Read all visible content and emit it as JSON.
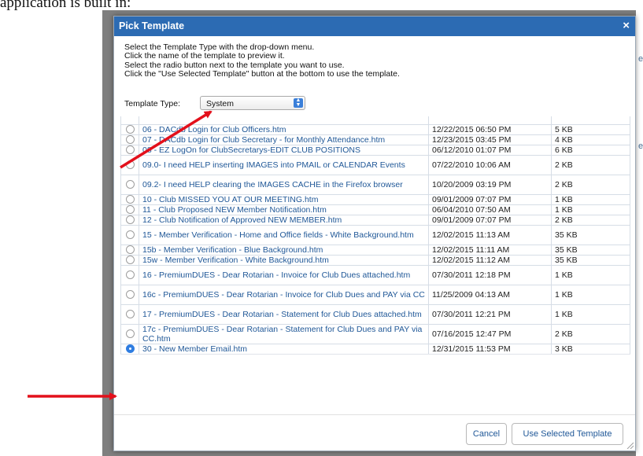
{
  "page": {
    "caption": "application is built in:",
    "background_letters": [
      "e",
      "e"
    ]
  },
  "dialog": {
    "title": "Pick Template",
    "close_symbol": "×",
    "instructions": [
      "Select the Template Type with the drop-down menu.",
      "Click the name of the template to preview it.",
      "Select the radio button next to the template you want to use.",
      "Click the \"Use Selected Template\" button at the bottom to use the template."
    ],
    "template_type": {
      "label": "Template Type:",
      "value": "System"
    },
    "templates": [
      {
        "name": "06 - DACdb Login for Club Officers.htm",
        "date": "12/22/2015 06:50 PM",
        "size": "5 KB",
        "selected": false
      },
      {
        "name": "07 - DACdb Login for Club Secretary - for Monthly Attendance.htm",
        "date": "12/23/2015 03:45 PM",
        "size": "4 KB",
        "selected": false
      },
      {
        "name": "08 - EZ LogOn for ClubSecretarys-EDIT CLUB POSITIONS",
        "date": "06/12/2010 01:07 PM",
        "size": "6 KB",
        "selected": false
      },
      {
        "name": "09.0- I need HELP inserting IMAGES into PMAIL or CALENDAR Events",
        "date": "07/22/2010 10:06 AM",
        "size": "2 KB",
        "selected": false
      },
      {
        "name": "09.2- I need HELP clearing the IMAGES CACHE in the Firefox browser",
        "date": "10/20/2009 03:19 PM",
        "size": "2 KB",
        "selected": false
      },
      {
        "name": "10 - Club MISSED YOU AT OUR MEETING.htm",
        "date": "09/01/2009 07:07 PM",
        "size": "1 KB",
        "selected": false
      },
      {
        "name": "11 - Club Proposed NEW Member Notification.htm",
        "date": "06/04/2010 07:50 AM",
        "size": "1 KB",
        "selected": false
      },
      {
        "name": "12 - Club Notification of Approved NEW MEMBER.htm",
        "date": "09/01/2009 07:07 PM",
        "size": "2 KB",
        "selected": false
      },
      {
        "name": "15 - Member Verification - Home and Office fields - White Background.htm",
        "date": "12/02/2015 11:13 AM",
        "size": "35 KB",
        "selected": false
      },
      {
        "name": "15b - Member Verification - Blue Background.htm",
        "date": "12/02/2015 11:11 AM",
        "size": "35 KB",
        "selected": false
      },
      {
        "name": "15w - Member Verification - White Background.htm",
        "date": "12/02/2015 11:12 AM",
        "size": "35 KB",
        "selected": false
      },
      {
        "name": "16 - PremiumDUES - Dear Rotarian - Invoice for Club Dues attached.htm",
        "date": "07/30/2011 12:18 PM",
        "size": "1 KB",
        "selected": false
      },
      {
        "name": "16c - PremiumDUES - Dear Rotarian - Invoice for Club Dues and PAY via CC",
        "date": "11/25/2009 04:13 AM",
        "size": "1 KB",
        "selected": false
      },
      {
        "name": "17 - PremiumDUES - Dear Rotarian - Statement for Club Dues attached.htm",
        "date": "07/30/2011 12:21 PM",
        "size": "1 KB",
        "selected": false
      },
      {
        "name": "17c - PremiumDUES - Dear Rotarian - Statement for Club Dues and PAY via CC.htm",
        "date": "07/16/2015 12:47 PM",
        "size": "2 KB",
        "selected": false
      },
      {
        "name": "30 - New Member Email.htm",
        "date": "12/31/2015 11:53 PM",
        "size": "3 KB",
        "selected": true
      }
    ],
    "buttons": {
      "cancel": "Cancel",
      "use_selected": "Use Selected Template"
    }
  },
  "annotations": {
    "arrow_color": "#e3101b"
  }
}
